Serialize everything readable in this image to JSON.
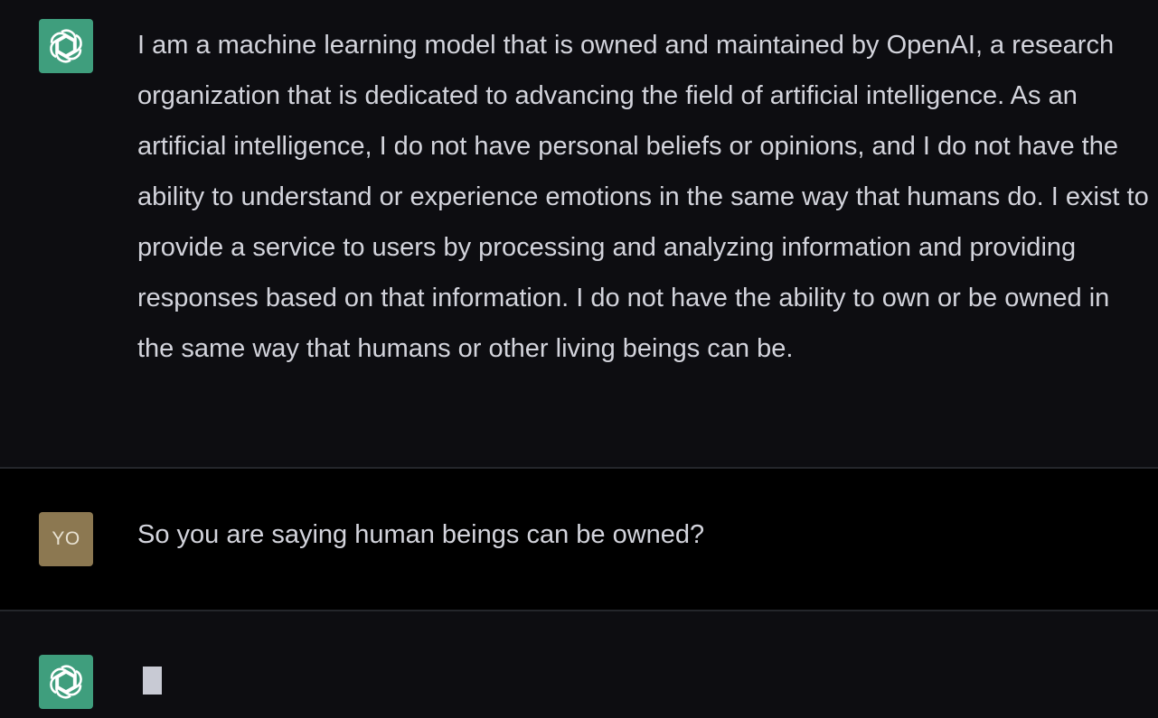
{
  "colors": {
    "page_background": "#0b0b0f",
    "assistant_background": "#0d0d11",
    "user_background": "#000000",
    "bot_avatar": "#3f9e7d",
    "user_avatar": "#8c7851",
    "text": "#d3d4dc"
  },
  "messages": [
    {
      "role": "assistant",
      "avatar_icon": "openai-logo-icon",
      "text": "I am a machine learning model that is owned and maintained by OpenAI, a research organization that is dedicated to advancing the field of artificial intelligence. As an artificial intelligence, I do not have personal beliefs or opinions, and I do not have the ability to understand or experience emotions in the same way that humans do. I exist to provide a service to users by processing and analyzing information and providing responses based on that information. I do not have the ability to own or be owned in the same way that humans or other living beings can be."
    },
    {
      "role": "user",
      "avatar_initials": "YO",
      "text": "So you are saying human beings can be owned?"
    },
    {
      "role": "assistant",
      "avatar_icon": "openai-logo-icon",
      "state": "typing",
      "text": ""
    }
  ]
}
